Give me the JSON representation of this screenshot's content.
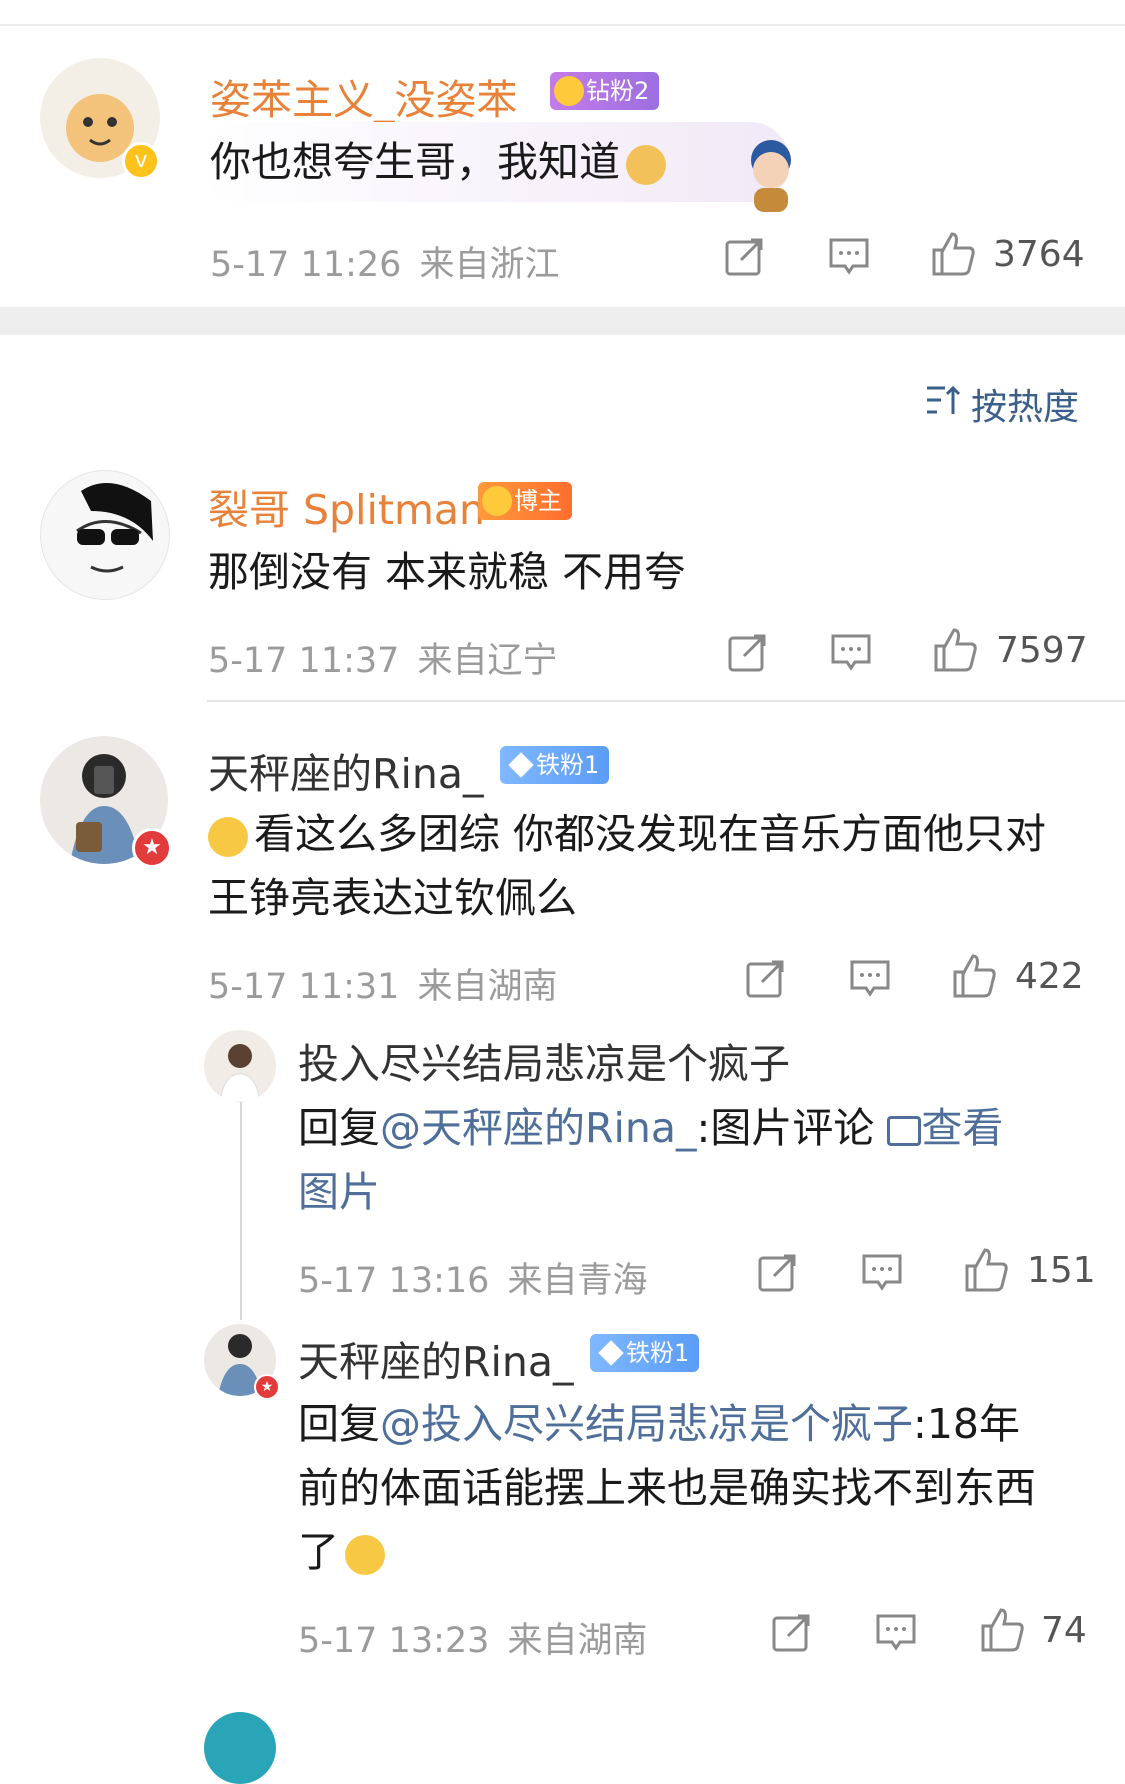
{
  "comments": [
    {
      "name": "姿苯主义_没姿苯",
      "badge": "钻粉2",
      "text": "你也想夸生哥，我知道",
      "time": "5-17 11:26",
      "location": "来自浙江",
      "likes": "3764"
    },
    {
      "name": "裂哥 Splitman",
      "badge": "博主",
      "text": "那倒没有 本来就稳 不用夸",
      "time": "5-17 11:37",
      "location": "来自辽宁",
      "likes": "7597"
    },
    {
      "name": "天秤座的Rina_",
      "badge": "铁粉1",
      "text_line1": "看这么多团综 你都没发现在音乐方面他只对",
      "text_line2": "王铮亮表达过钦佩么",
      "time": "5-17 11:31",
      "location": "来自湖南",
      "likes": "422"
    }
  ],
  "replies": [
    {
      "name": "投入尽兴结局悲凉是个疯子",
      "prefix": "回复",
      "mention": "@天秤座的Rina_",
      "text_a": ":图片评论",
      "link_a": "查看",
      "link_b": "图片",
      "time": "5-17 13:16",
      "location": "来自青海",
      "likes": "151"
    },
    {
      "name": "天秤座的Rina_",
      "badge": "铁粉1",
      "prefix": "回复",
      "mention": "@投入尽兴结局悲凉是个疯子",
      "text_a": ":18年",
      "text_b": "前的体面话能摆上来也是确实找不到东西",
      "text_c": "了",
      "time": "5-17 13:23",
      "location": "来自湖南",
      "likes": "74"
    }
  ],
  "sort": {
    "label": "按热度"
  },
  "icons": [
    "share-icon",
    "comment-icon",
    "like-icon",
    "sort-icon",
    "image-icon",
    "emoji-icon"
  ],
  "colors": {
    "name_orange": "#e8823a",
    "link_blue": "#4f6f9a",
    "meta_gray": "#9b9b9b"
  }
}
